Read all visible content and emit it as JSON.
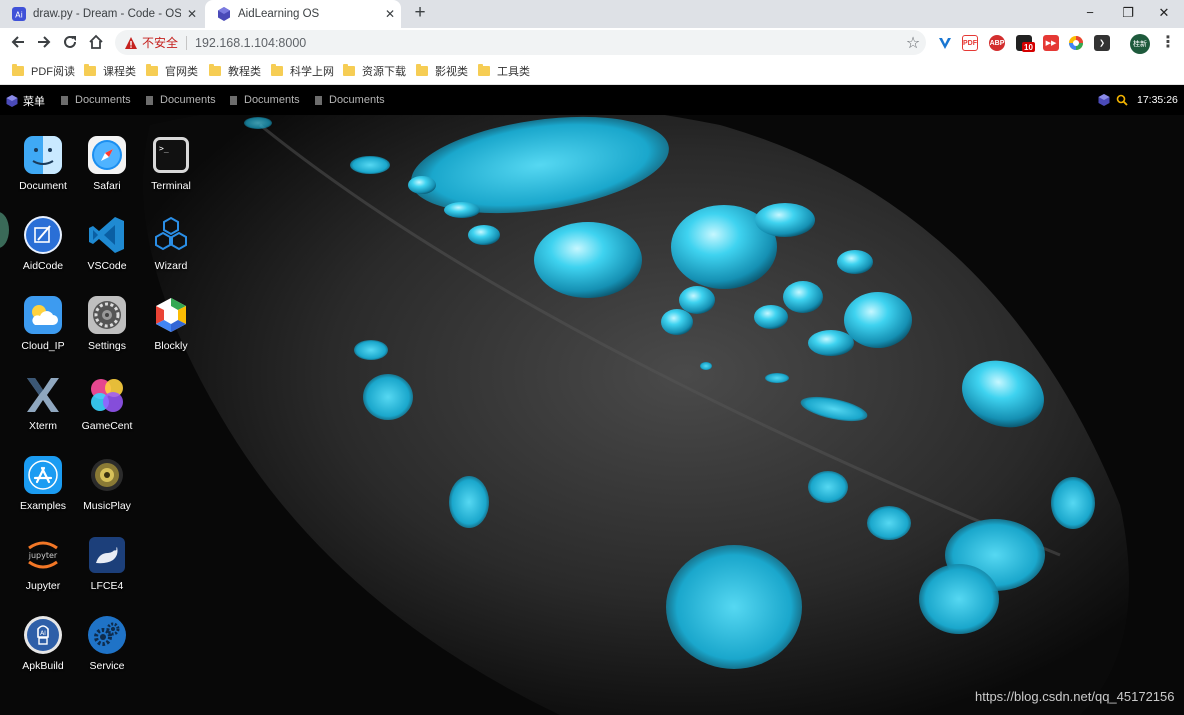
{
  "tabs": [
    {
      "title": "draw.py - Dream - Code - OS"
    },
    {
      "title": "AidLearning OS"
    }
  ],
  "toolbar": {
    "security_label": "不安全",
    "url": "192.168.1.104:8000",
    "extension_badge": "10",
    "profile_label": "桂新"
  },
  "bookmarks": [
    "PDF阅读",
    "课程类",
    "官网类",
    "教程类",
    "科学上网",
    "资源下载",
    "影视类",
    "工具类"
  ],
  "panel": {
    "menu_label": "菜单",
    "tasks": [
      "Documents",
      "Documents",
      "Documents",
      "Documents"
    ],
    "clock": "17:35:26"
  },
  "desktop_icons": [
    {
      "label": "Document",
      "icon": "finder-icon"
    },
    {
      "label": "Safari",
      "icon": "safari-icon"
    },
    {
      "label": "Terminal",
      "icon": "terminal-icon"
    },
    {
      "label": "AidCode",
      "icon": "aidcode-icon"
    },
    {
      "label": "VSCode",
      "icon": "vscode-icon"
    },
    {
      "label": "Wizard",
      "icon": "wizard-cubes-icon"
    },
    {
      "label": "Cloud_IP",
      "icon": "cloud-weather-icon"
    },
    {
      "label": "Settings",
      "icon": "settings-gear-icon"
    },
    {
      "label": "Blockly",
      "icon": "blockly-icon"
    },
    {
      "label": "Xterm",
      "icon": "xterm-icon"
    },
    {
      "label": "GameCent",
      "icon": "game-center-icon"
    },
    {
      "label": "Examples",
      "icon": "app-store-icon"
    },
    {
      "label": "MusicPlay",
      "icon": "speaker-icon"
    },
    {
      "label": "Jupyter",
      "icon": "jupyter-icon"
    },
    {
      "label": "LFCE4",
      "icon": "xfce-mouse-icon"
    },
    {
      "label": "ApkBuild",
      "icon": "apk-build-icon"
    },
    {
      "label": "Service",
      "icon": "service-gears-icon"
    }
  ],
  "watermark": "https://blog.csdn.net/qq_45172156",
  "colors": {
    "accent_cyan": "#22c6e6",
    "tab_strip": "#dee1e6",
    "insecure_red": "#c5221f"
  }
}
